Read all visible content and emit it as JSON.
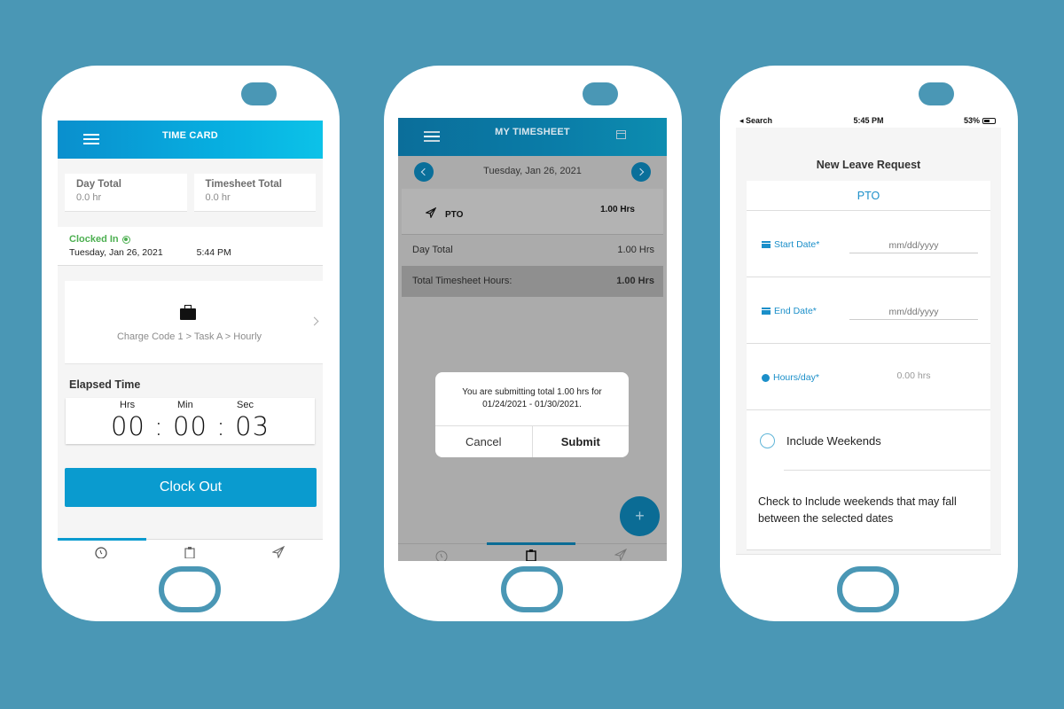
{
  "phones": {
    "time_card": {
      "header": {
        "title": "TIME CARD",
        "menu_icon": "hamburger-icon"
      },
      "totals": [
        {
          "label": "Day Total",
          "value": "0.0 hr"
        },
        {
          "label": "Timesheet Total",
          "value": "0.0 hr"
        }
      ],
      "status": {
        "label": "Clocked In",
        "date": "Tuesday, Jan 26, 2021",
        "time": "5:44 PM"
      },
      "charge": {
        "icon": "briefcase-icon",
        "path": "Charge Code 1 > Task A > Hourly"
      },
      "elapsed": {
        "label": "Elapsed Time",
        "units": [
          "Hrs",
          "Min",
          "Sec"
        ],
        "display": "00 : 00 : 03"
      },
      "clock_out_label": "Clock Out",
      "tabs": [
        {
          "icon": "clock-icon",
          "active": true
        },
        {
          "icon": "clipboard-icon",
          "active": false
        },
        {
          "icon": "paper-plane-icon",
          "active": false
        }
      ]
    },
    "my_timesheet": {
      "header": {
        "title": "MY TIMESHEET",
        "menu_icon": "hamburger-icon",
        "calendar_icon": "calendar-icon"
      },
      "date": "Tuesday, Jan 26, 2021",
      "entries": [
        {
          "icon": "paper-plane-icon",
          "name": "PTO",
          "hours": "1.00 Hrs"
        }
      ],
      "day_total": {
        "label": "Day Total",
        "value": "1.00 Hrs"
      },
      "timesheet_total": {
        "label": "Total Timesheet Hours:",
        "value": "1.00 Hrs"
      },
      "dialog": {
        "line1": "You are submitting total 1.00 hrs for",
        "line2": "01/24/2021 - 01/30/2021.",
        "cancel_label": "Cancel",
        "submit_label": "Submit"
      },
      "fab_label": "+",
      "tabs": [
        {
          "icon": "clock-icon",
          "active": false
        },
        {
          "icon": "clipboard-icon",
          "active": true
        },
        {
          "icon": "paper-plane-icon",
          "active": false
        }
      ]
    },
    "leave_request": {
      "status_bar": {
        "back": "◂ Search",
        "time": "5:45 PM",
        "battery": "53%"
      },
      "title": "New Leave Request",
      "leave_type": "PTO",
      "start_date": {
        "label": "Start Date*",
        "placeholder": "mm/dd/yyyy"
      },
      "end_date": {
        "label": "End Date*",
        "placeholder": "mm/dd/yyyy"
      },
      "hours_per_day": {
        "label": "Hours/day*",
        "value": "0.00 hrs"
      },
      "include_weekends": {
        "label": "Include Weekends",
        "checked": false
      },
      "hint": "Check to Include weekends that may fall between the selected dates"
    }
  }
}
